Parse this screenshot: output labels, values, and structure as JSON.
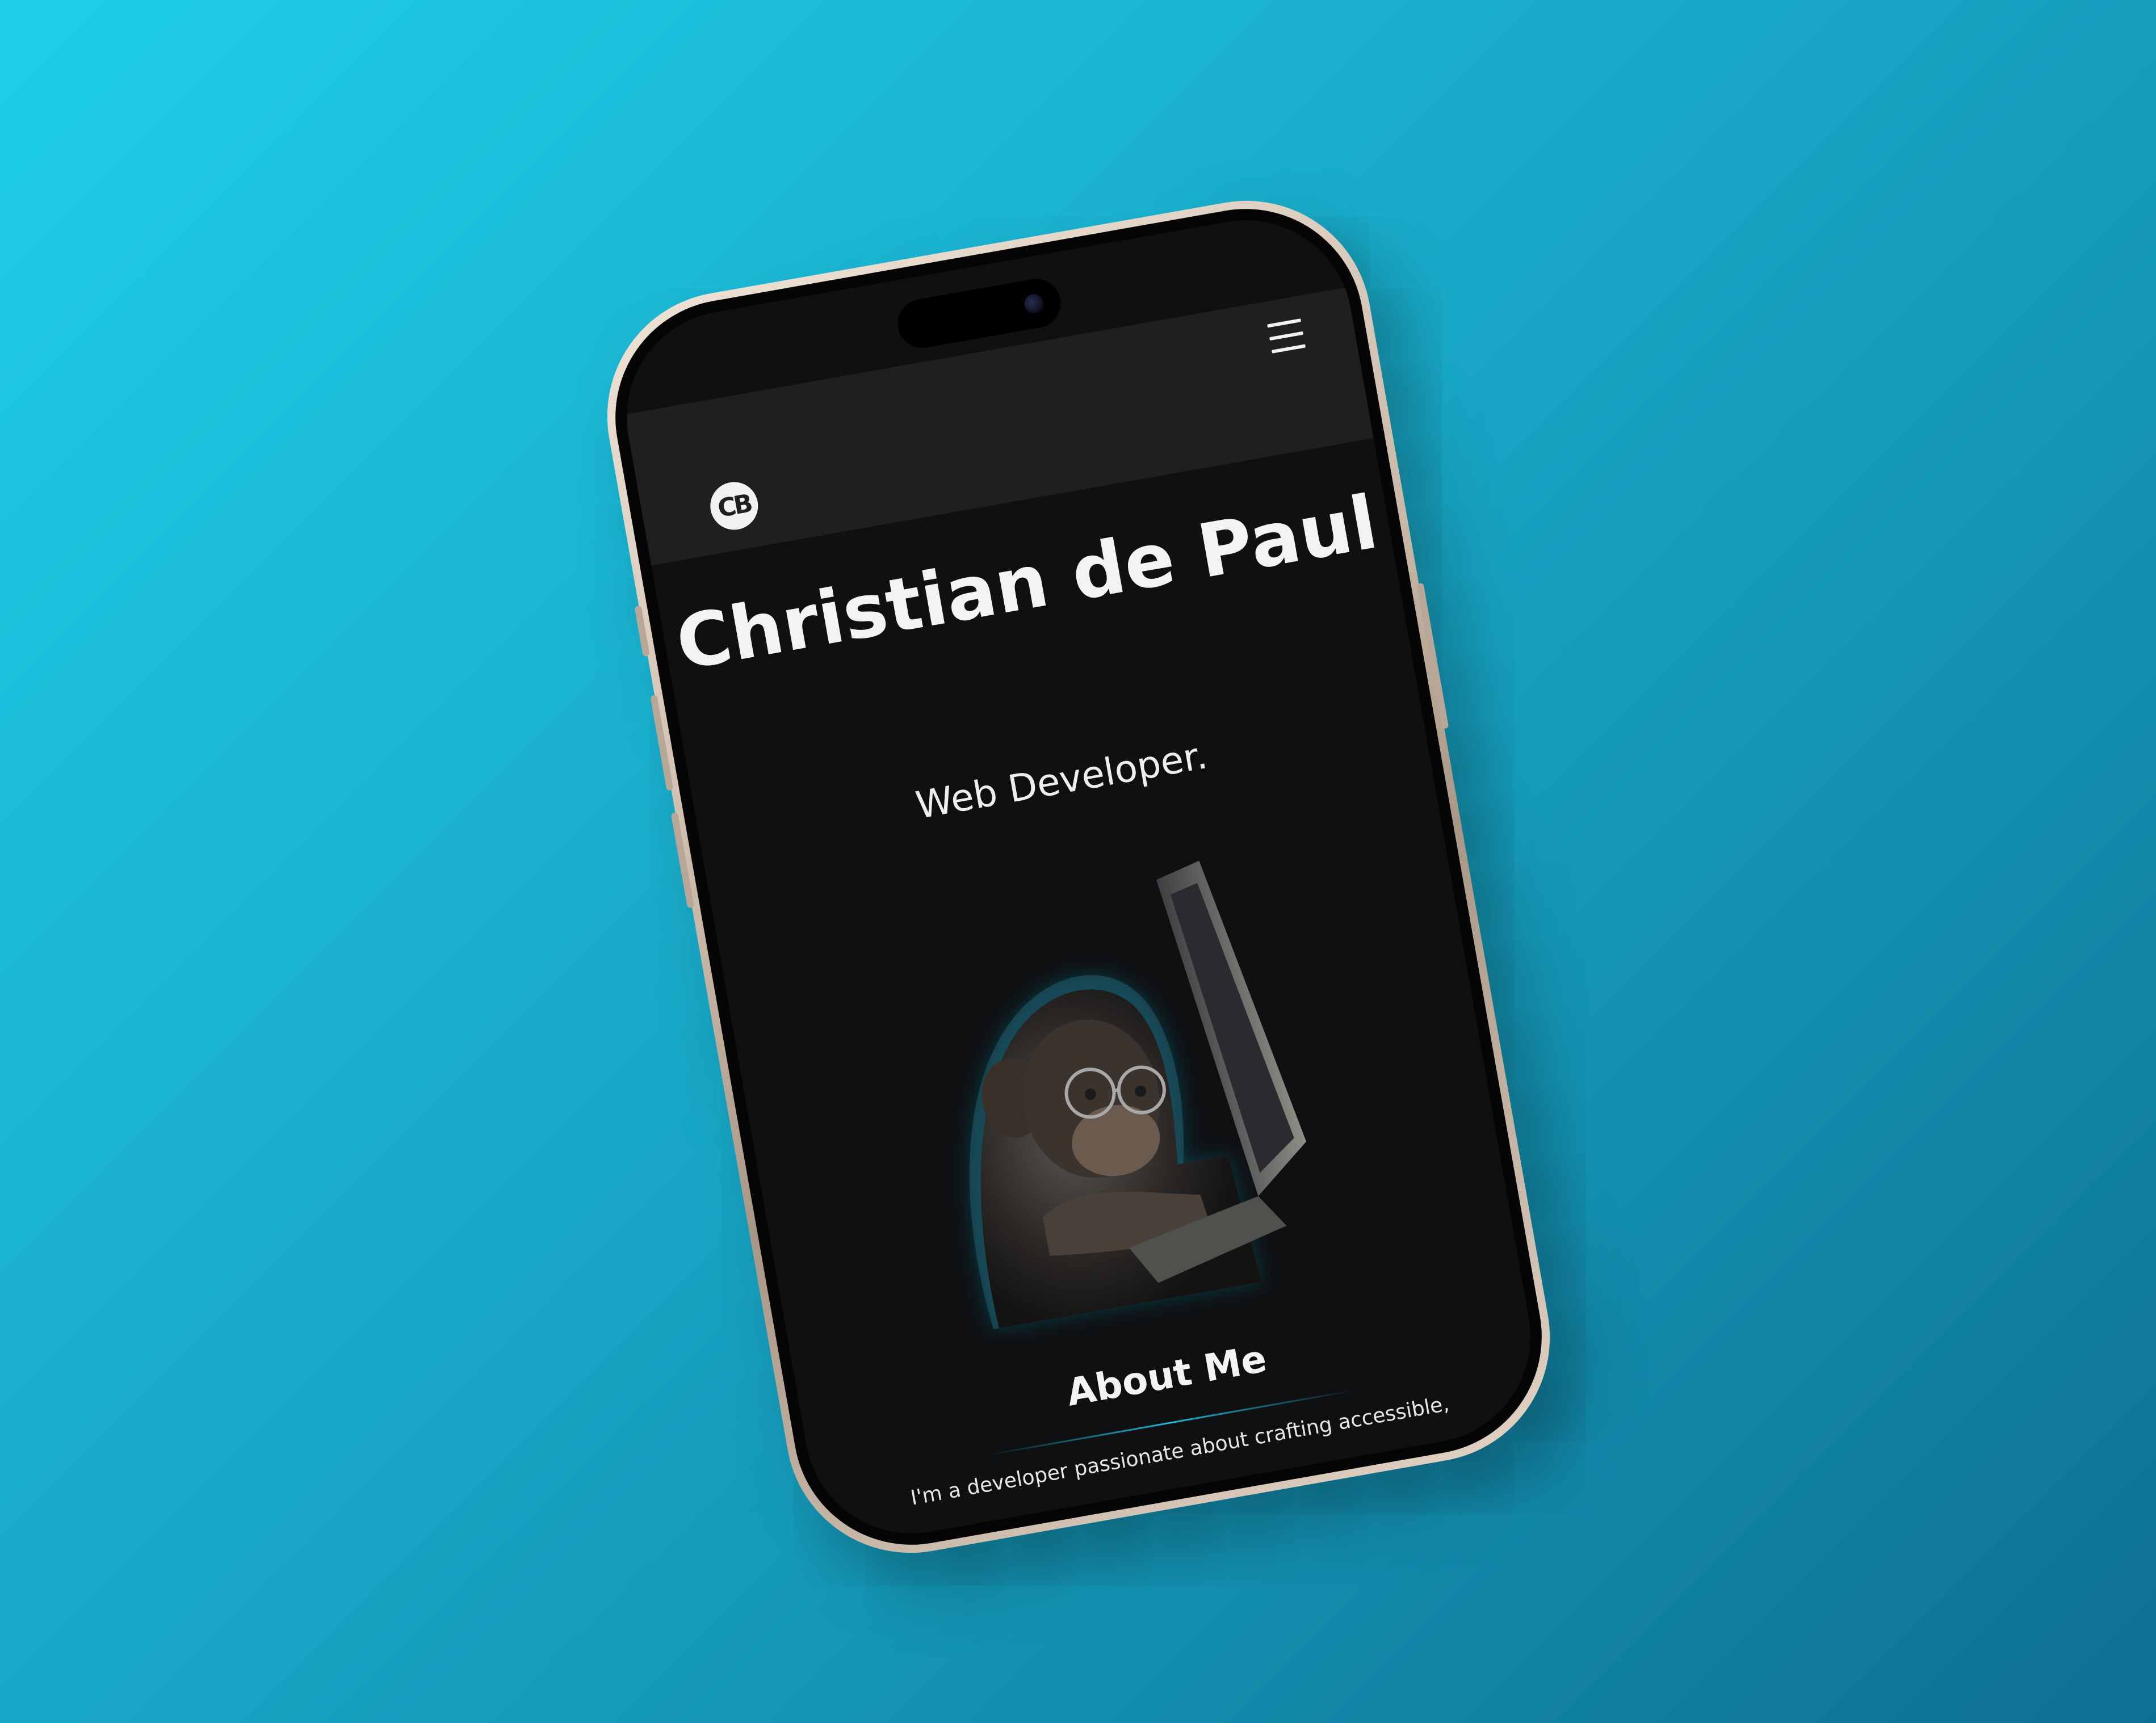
{
  "site": {
    "logo_text": "CB",
    "menu_icon": "hamburger-menu-icon"
  },
  "hero": {
    "name": "Christian de Paul",
    "role": "Web Developer.",
    "image": "monkey-coding-on-laptop-illustration"
  },
  "about": {
    "title": "About Me",
    "intro": "I'm a developer passionate about crafting accessible,"
  },
  "colors": {
    "background_start": "#1fcfe9",
    "background_end": "#0e6f93",
    "screen_bg": "#0f1012",
    "navbar_bg": "#1f1f20",
    "text": "#f3f3f3",
    "accent_glow": "#1fb6d6"
  }
}
